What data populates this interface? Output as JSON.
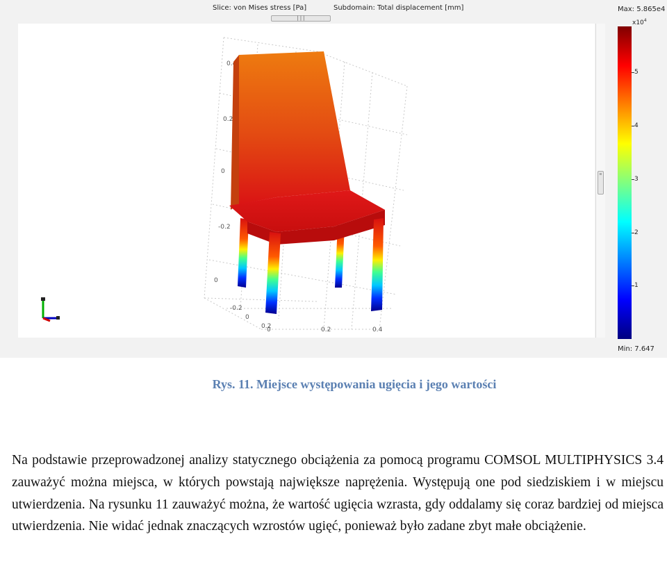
{
  "figure": {
    "title_slice": "Slice: von Mises stress [Pa]",
    "title_subdomain": "Subdomain: Total displacement [mm]",
    "scroll_grip": "|||",
    "colorbar": {
      "max_label": "Max: 5.865e4",
      "multiplier_base": "x10",
      "multiplier_exp": "4",
      "min_label": "Min: 7.647",
      "ticks": [
        {
          "value": 1,
          "label": "1"
        },
        {
          "value": 2,
          "label": "2"
        },
        {
          "value": 3,
          "label": "3"
        },
        {
          "value": 4,
          "label": "4"
        },
        {
          "value": 5,
          "label": "5"
        }
      ],
      "range": [
        0.000765,
        5.865
      ],
      "colors": [
        "#800000",
        "#ff0000",
        "#ff8000",
        "#ffff00",
        "#80ff80",
        "#00ffff",
        "#0080ff",
        "#0000ff",
        "#000080"
      ]
    },
    "axes": {
      "z_ticks": [
        "0.4",
        "0.2",
        "0",
        "-0.2",
        "0"
      ],
      "y_ticks": [
        "-0.2",
        "0",
        "0.2"
      ],
      "x_ticks": [
        "0",
        "0.2",
        "0.4"
      ]
    }
  },
  "caption": "Rys. 11. Miejsce występowania ugięcia i jego wartości",
  "paragraph": "Na podstawie przeprowadzonej analizy statycznego obciążenia za pomocą programu COMSOL MULTIPHYSICS 3.4 zauważyć można miejsca, w których powstają największe naprężenia. Występują one pod siedziskiem i w miejscu utwierdzenia. Na rysunku 11 zauważyć można, że wartość ugięcia wzrasta, gdy oddalamy się coraz bardziej od miejsca utwierdzenia. Nie widać jednak znaczących wzrostów ugięć, ponieważ było zadane zbyt małe obciążenie."
}
